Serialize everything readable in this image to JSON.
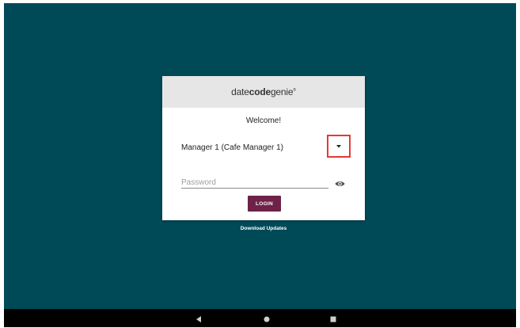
{
  "logo": {
    "part1": "date",
    "part2": "code",
    "part3": "genie",
    "trademark": "®"
  },
  "login": {
    "welcome": "Welcome!",
    "selected_user": "Manager 1 (Cafe Manager 1)",
    "password_placeholder": "Password",
    "password_value": "",
    "login_label": "LOGIN"
  },
  "footer": {
    "download_label": "Download Updates"
  },
  "icons": {
    "dropdown": "arrow-drop-down-icon",
    "password_toggle": "eye-icon",
    "nav_back": "back-triangle-icon",
    "nav_home": "home-circle-icon",
    "nav_recents": "recents-square-icon"
  },
  "colors": {
    "background": "#004a58",
    "login_button": "#6e2248",
    "highlight_border": "#e53935",
    "header": "#e6e6e6"
  }
}
